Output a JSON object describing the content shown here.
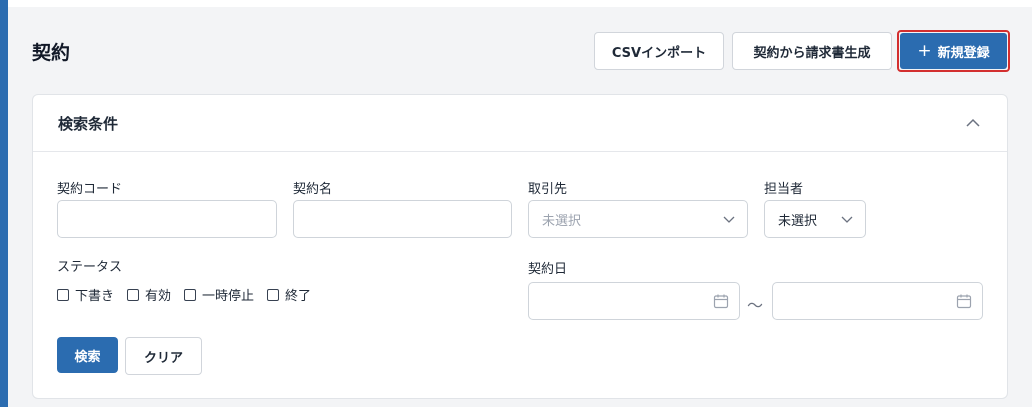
{
  "page": {
    "title": "契約"
  },
  "header_actions": {
    "csv_import": "CSVインポート",
    "generate_invoice": "契約から請求書生成",
    "new_register": "新規登録",
    "new_register_icon": "plus-icon"
  },
  "search_panel": {
    "title": "検索条件",
    "collapse_icon": "chevron-up-icon",
    "fields": {
      "contract_code": {
        "label": "契約コード",
        "value": ""
      },
      "contract_name": {
        "label": "契約名",
        "value": ""
      },
      "client": {
        "label": "取引先",
        "placeholder": "未選択"
      },
      "assignee": {
        "label": "担当者",
        "value": "未選択"
      },
      "status": {
        "label": "ステータス",
        "options": [
          {
            "label": "下書き",
            "checked": false
          },
          {
            "label": "有効",
            "checked": false
          },
          {
            "label": "一時停止",
            "checked": false
          },
          {
            "label": "終了",
            "checked": false
          }
        ]
      },
      "contract_date": {
        "label": "契約日",
        "separator": "〜",
        "from": "",
        "to": ""
      }
    },
    "buttons": {
      "search": "検索",
      "clear": "クリア"
    }
  },
  "colors": {
    "primary": "#2b6cb0",
    "highlight_border": "#d32f2f",
    "page_bg": "#f3f4f6"
  }
}
